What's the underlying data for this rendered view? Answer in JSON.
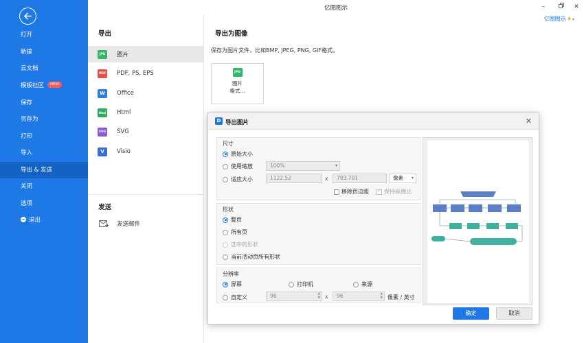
{
  "app": {
    "title": "亿图图示",
    "brand": "亿图图示",
    "window_controls": {
      "minimize": "–",
      "close": "✕"
    }
  },
  "sidebar": {
    "items": [
      {
        "label": "打开"
      },
      {
        "label": "新建"
      },
      {
        "label": "云文档"
      },
      {
        "label": "模板社区",
        "badge": "NEW"
      },
      {
        "label": "保存"
      },
      {
        "label": "另存为"
      },
      {
        "label": "打印"
      },
      {
        "label": "导入"
      },
      {
        "label": "导出 & 发送",
        "active": true
      },
      {
        "label": "关闭"
      },
      {
        "label": "选项"
      },
      {
        "label": "退出"
      }
    ]
  },
  "export_panel": {
    "header": "导出",
    "formats": [
      {
        "label": "图片",
        "icon": "JPG",
        "color": "#35b56a"
      },
      {
        "label": "PDF, PS, EPS",
        "icon": "PDF",
        "color": "#e5524a"
      },
      {
        "label": "Office",
        "icon": "W",
        "color": "#2d7de0"
      },
      {
        "label": "Html",
        "icon": "Html",
        "color": "#2faa5e"
      },
      {
        "label": "SVG",
        "icon": "SVG",
        "color": "#8a5ad8"
      },
      {
        "label": "Visio",
        "icon": "V",
        "color": "#3a6fd8"
      }
    ],
    "send_header": "发送",
    "send_item": "发送邮件"
  },
  "content": {
    "header": "导出为图像",
    "description": "保存为图片文件，比如BMP, JPEG, PNG, GIF格式。",
    "card": {
      "icon": "JPG",
      "line1": "图片",
      "line2": "格式..."
    }
  },
  "dialog": {
    "title": "导出图片",
    "size": {
      "title": "尺寸",
      "original": "原始大小",
      "use_zoom": "使用缩放",
      "zoom_value": "100%",
      "fit_size": "适应大小",
      "width": "1122.52",
      "height": "793.701",
      "unit": "像素",
      "remove_margin": "移除页边距",
      "keep_ratio": "保持纵横比"
    },
    "shape": {
      "title": "形状",
      "whole_page": "整页",
      "all_pages": "所有页",
      "selected": "选中的形状",
      "current_all": "当前活动页所有形状"
    },
    "resolution": {
      "title": "分辨率",
      "screen": "屏幕",
      "printer": "打印机",
      "source": "来源",
      "custom": "自定义",
      "x_dpi": "96",
      "y_dpi": "96",
      "unit": "像素 / 英寸"
    },
    "ok": "确定",
    "cancel": "取消"
  },
  "colors": {
    "sidebar": "#1e78e6",
    "sidebar_active": "#1462c4",
    "accent": "#1e78e6",
    "flow_blue": "#5b7fc6",
    "flow_teal": "#3fb29f"
  }
}
